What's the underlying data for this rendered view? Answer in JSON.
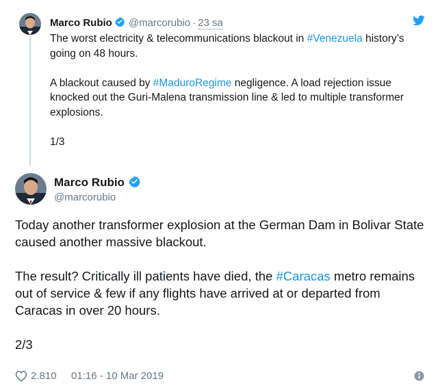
{
  "parent_tweet": {
    "author_name": "Marco Rubio",
    "handle": "@marcorubio",
    "separator": "·",
    "time": "23 sa",
    "line1_pre": "The worst electricity & telecommunications blackout in ",
    "line1_tag": "#Venezuela",
    "line1_post": " history’s going on 48 hours.",
    "para2_pre": "A blackout caused by ",
    "para2_tag": "#MaduroRegime",
    "para2_post": " negligence. A load rejection issue knocked out the Guri-Malena transmission line & led to multiple transformer explosions.",
    "counter": "1/3"
  },
  "main_tweet": {
    "author_name": "Marco Rubio",
    "handle": "@marcorubio",
    "para1": "Today another transformer explosion at the German Dam in Bolivar State caused another massive blackout.",
    "para2_pre": "The result? Critically ill patients have died, the ",
    "para2_tag": "#Caracas",
    "para2_post": " metro remains out of service & few if any flights have arrived at or departed from Caracas in over 20 hours.",
    "counter": "2/3",
    "likes": "2.810",
    "timestamp": "01:16 - 10 Mar 2019"
  },
  "colors": {
    "link": "#1b95e0",
    "verified": "#1da1f2",
    "muted": "#657786",
    "text": "#14171a"
  },
  "icons": [
    "verified-badge-icon",
    "twitter-bird-icon",
    "heart-icon",
    "info-icon"
  ]
}
